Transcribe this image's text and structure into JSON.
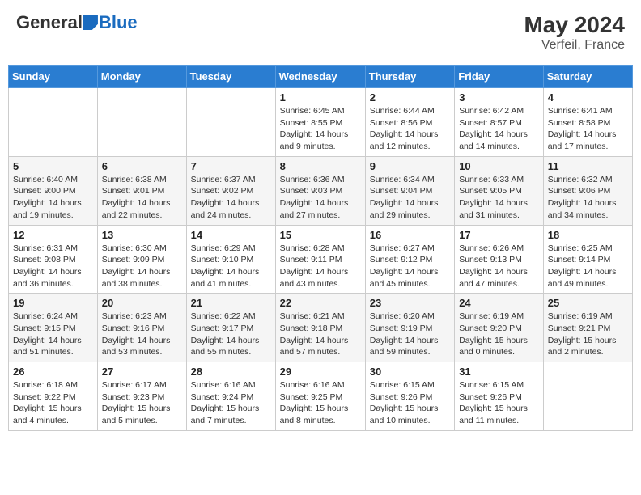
{
  "header": {
    "logo_general": "General",
    "logo_blue": "Blue",
    "month_year": "May 2024",
    "location": "Verfeil, France"
  },
  "days_of_week": [
    "Sunday",
    "Monday",
    "Tuesday",
    "Wednesday",
    "Thursday",
    "Friday",
    "Saturday"
  ],
  "weeks": [
    [
      {
        "day": "",
        "info": ""
      },
      {
        "day": "",
        "info": ""
      },
      {
        "day": "",
        "info": ""
      },
      {
        "day": "1",
        "info": "Sunrise: 6:45 AM\nSunset: 8:55 PM\nDaylight: 14 hours and 9 minutes."
      },
      {
        "day": "2",
        "info": "Sunrise: 6:44 AM\nSunset: 8:56 PM\nDaylight: 14 hours and 12 minutes."
      },
      {
        "day": "3",
        "info": "Sunrise: 6:42 AM\nSunset: 8:57 PM\nDaylight: 14 hours and 14 minutes."
      },
      {
        "day": "4",
        "info": "Sunrise: 6:41 AM\nSunset: 8:58 PM\nDaylight: 14 hours and 17 minutes."
      }
    ],
    [
      {
        "day": "5",
        "info": "Sunrise: 6:40 AM\nSunset: 9:00 PM\nDaylight: 14 hours and 19 minutes."
      },
      {
        "day": "6",
        "info": "Sunrise: 6:38 AM\nSunset: 9:01 PM\nDaylight: 14 hours and 22 minutes."
      },
      {
        "day": "7",
        "info": "Sunrise: 6:37 AM\nSunset: 9:02 PM\nDaylight: 14 hours and 24 minutes."
      },
      {
        "day": "8",
        "info": "Sunrise: 6:36 AM\nSunset: 9:03 PM\nDaylight: 14 hours and 27 minutes."
      },
      {
        "day": "9",
        "info": "Sunrise: 6:34 AM\nSunset: 9:04 PM\nDaylight: 14 hours and 29 minutes."
      },
      {
        "day": "10",
        "info": "Sunrise: 6:33 AM\nSunset: 9:05 PM\nDaylight: 14 hours and 31 minutes."
      },
      {
        "day": "11",
        "info": "Sunrise: 6:32 AM\nSunset: 9:06 PM\nDaylight: 14 hours and 34 minutes."
      }
    ],
    [
      {
        "day": "12",
        "info": "Sunrise: 6:31 AM\nSunset: 9:08 PM\nDaylight: 14 hours and 36 minutes."
      },
      {
        "day": "13",
        "info": "Sunrise: 6:30 AM\nSunset: 9:09 PM\nDaylight: 14 hours and 38 minutes."
      },
      {
        "day": "14",
        "info": "Sunrise: 6:29 AM\nSunset: 9:10 PM\nDaylight: 14 hours and 41 minutes."
      },
      {
        "day": "15",
        "info": "Sunrise: 6:28 AM\nSunset: 9:11 PM\nDaylight: 14 hours and 43 minutes."
      },
      {
        "day": "16",
        "info": "Sunrise: 6:27 AM\nSunset: 9:12 PM\nDaylight: 14 hours and 45 minutes."
      },
      {
        "day": "17",
        "info": "Sunrise: 6:26 AM\nSunset: 9:13 PM\nDaylight: 14 hours and 47 minutes."
      },
      {
        "day": "18",
        "info": "Sunrise: 6:25 AM\nSunset: 9:14 PM\nDaylight: 14 hours and 49 minutes."
      }
    ],
    [
      {
        "day": "19",
        "info": "Sunrise: 6:24 AM\nSunset: 9:15 PM\nDaylight: 14 hours and 51 minutes."
      },
      {
        "day": "20",
        "info": "Sunrise: 6:23 AM\nSunset: 9:16 PM\nDaylight: 14 hours and 53 minutes."
      },
      {
        "day": "21",
        "info": "Sunrise: 6:22 AM\nSunset: 9:17 PM\nDaylight: 14 hours and 55 minutes."
      },
      {
        "day": "22",
        "info": "Sunrise: 6:21 AM\nSunset: 9:18 PM\nDaylight: 14 hours and 57 minutes."
      },
      {
        "day": "23",
        "info": "Sunrise: 6:20 AM\nSunset: 9:19 PM\nDaylight: 14 hours and 59 minutes."
      },
      {
        "day": "24",
        "info": "Sunrise: 6:19 AM\nSunset: 9:20 PM\nDaylight: 15 hours and 0 minutes."
      },
      {
        "day": "25",
        "info": "Sunrise: 6:19 AM\nSunset: 9:21 PM\nDaylight: 15 hours and 2 minutes."
      }
    ],
    [
      {
        "day": "26",
        "info": "Sunrise: 6:18 AM\nSunset: 9:22 PM\nDaylight: 15 hours and 4 minutes."
      },
      {
        "day": "27",
        "info": "Sunrise: 6:17 AM\nSunset: 9:23 PM\nDaylight: 15 hours and 5 minutes."
      },
      {
        "day": "28",
        "info": "Sunrise: 6:16 AM\nSunset: 9:24 PM\nDaylight: 15 hours and 7 minutes."
      },
      {
        "day": "29",
        "info": "Sunrise: 6:16 AM\nSunset: 9:25 PM\nDaylight: 15 hours and 8 minutes."
      },
      {
        "day": "30",
        "info": "Sunrise: 6:15 AM\nSunset: 9:26 PM\nDaylight: 15 hours and 10 minutes."
      },
      {
        "day": "31",
        "info": "Sunrise: 6:15 AM\nSunset: 9:26 PM\nDaylight: 15 hours and 11 minutes."
      },
      {
        "day": "",
        "info": ""
      }
    ]
  ]
}
